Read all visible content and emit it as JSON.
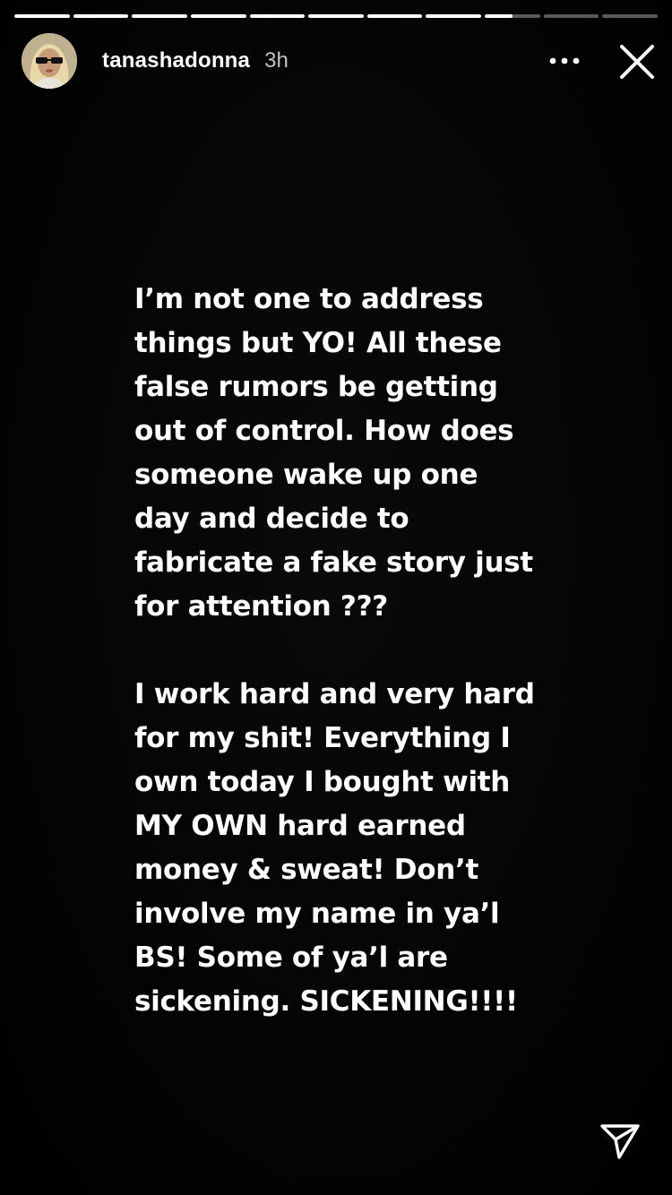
{
  "story": {
    "segments": [
      {
        "progress": 1.0
      },
      {
        "progress": 1.0
      },
      {
        "progress": 1.0
      },
      {
        "progress": 1.0
      },
      {
        "progress": 1.0
      },
      {
        "progress": 1.0
      },
      {
        "progress": 1.0
      },
      {
        "progress": 1.0
      },
      {
        "progress": 0.5
      },
      {
        "progress": 0.0
      },
      {
        "progress": 0.0
      }
    ],
    "active_segment_index": 8
  },
  "header": {
    "username": "tanashadonna",
    "time": "3h",
    "avatar_icon": "avatar-photo",
    "more_icon": "more-options-icon",
    "close_icon": "close-icon"
  },
  "message": {
    "paragraph_1": [
      "I’m not one to address",
      "things but YO! All these",
      "false rumors be getting",
      "out of control. How does",
      "someone wake up one",
      "day and decide to",
      "fabricate a fake story just",
      "for attention ???"
    ],
    "paragraph_2": [
      "I work hard and very hard",
      "for my shit! Everything I",
      "own today I bought with",
      "MY OWN hard earned",
      "money & sweat! Don’t",
      "involve my name in ya’l",
      "BS! Some of ya’l are",
      "sickening. SICKENING!!!!"
    ]
  },
  "footer": {
    "send_icon": "send-icon"
  },
  "colors": {
    "background": "#000000",
    "text": "#ffffff",
    "progress_track": "rgba(255,255,255,0.35)",
    "progress_fill": "#ffffff"
  }
}
